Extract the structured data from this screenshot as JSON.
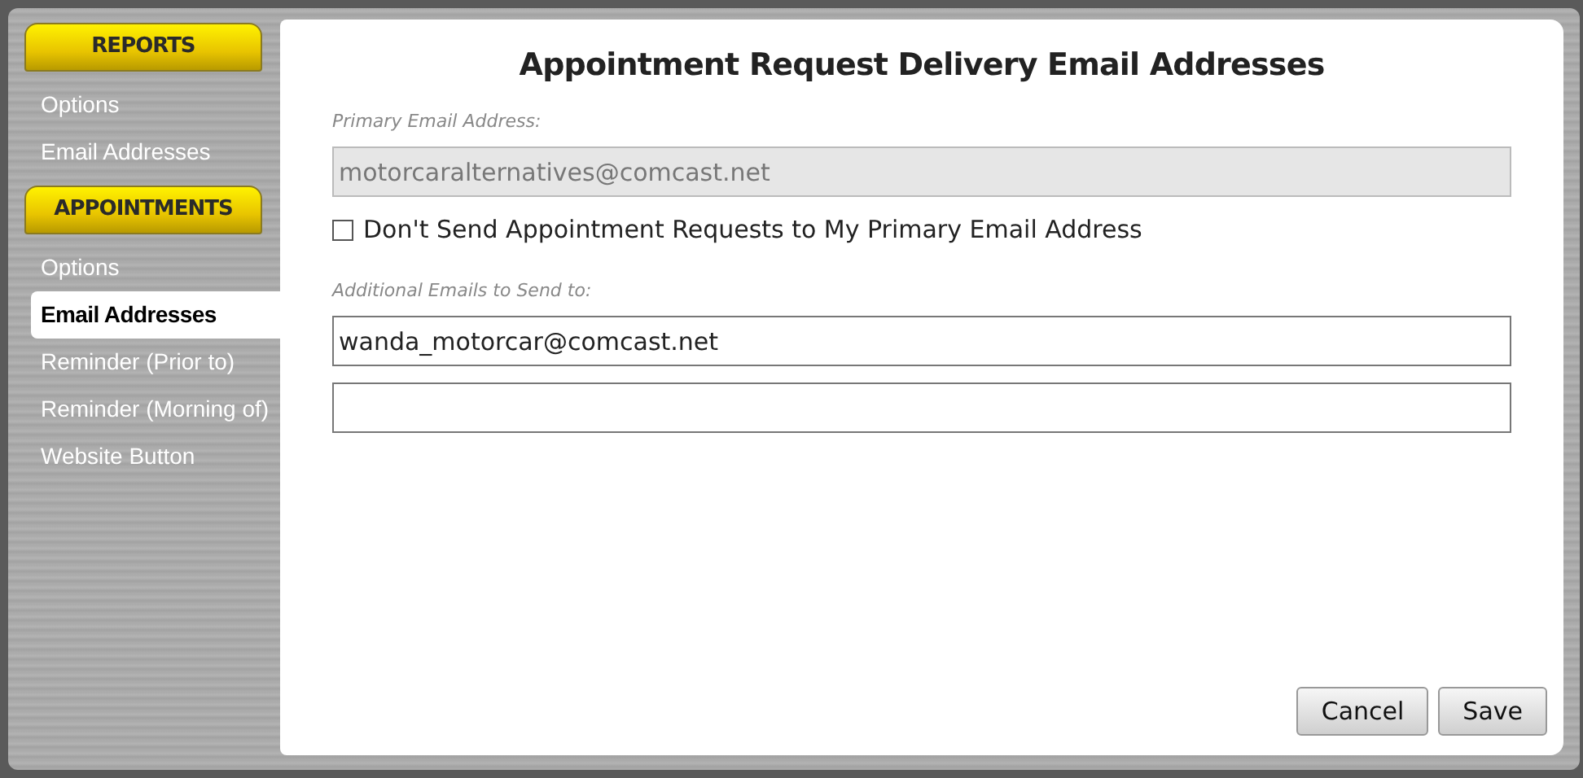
{
  "sidebar": {
    "sections": [
      {
        "heading": "REPORTS",
        "items": [
          {
            "label": "Options",
            "selected": false
          },
          {
            "label": "Email Addresses",
            "selected": false
          }
        ]
      },
      {
        "heading": "APPOINTMENTS",
        "items": [
          {
            "label": "Options",
            "selected": false
          },
          {
            "label": "Email Addresses",
            "selected": true
          },
          {
            "label": "Reminder (Prior to)",
            "selected": false
          },
          {
            "label": "Reminder (Morning of)",
            "selected": false
          },
          {
            "label": "Website Button",
            "selected": false
          }
        ]
      }
    ]
  },
  "dialog": {
    "title": "Appointment Request Delivery Email Addresses",
    "primary": {
      "label": "Primary Email Address:",
      "value": "motorcaralternatives@comcast.net",
      "disabled": true
    },
    "checkbox": {
      "label": "Don't Send Appointment Requests to My Primary Email Address",
      "checked": false
    },
    "additional": {
      "label": "Additional Emails to Send to:",
      "fields": [
        {
          "kind": "filled",
          "value": "wanda_motorcar@comcast.net"
        },
        {
          "kind": "empty"
        }
      ]
    },
    "buttons": [
      "Cancel",
      "Save"
    ]
  }
}
